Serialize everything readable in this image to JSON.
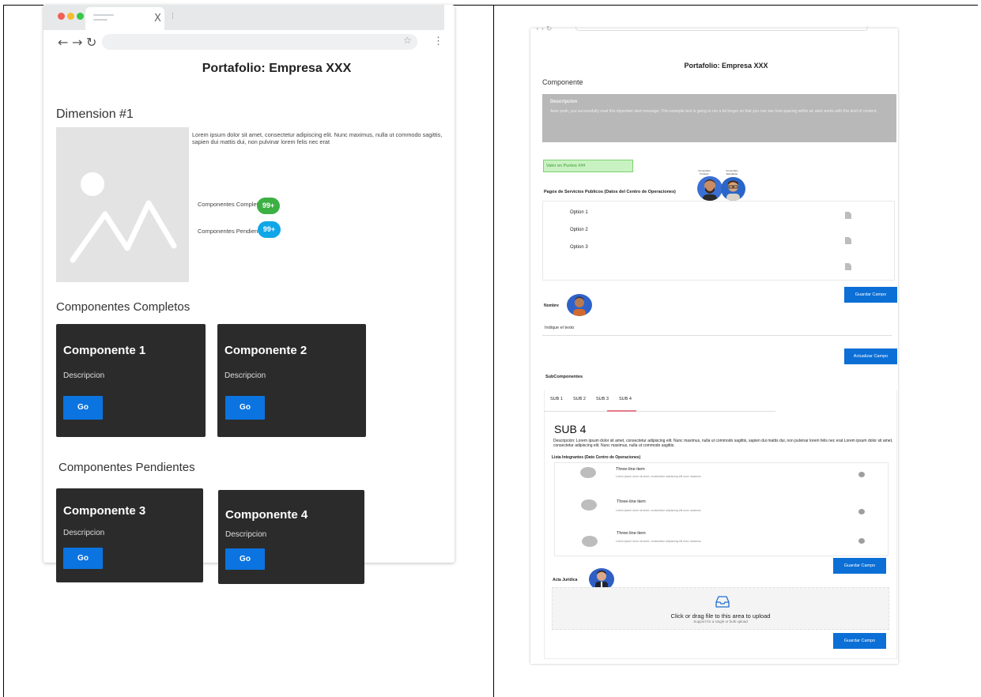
{
  "left": {
    "tab_close": "X",
    "page_title": "Portafolio: Empresa XXX",
    "dimension_title": "Dimension #1",
    "lorem": "Lorem ipsum dolor sit amet, consectetur adipiscing elit. Nunc maximus, nulla ut commodo sagittis, sapien dui mattis dui, non pulvinar lorem felis nec erat",
    "completos_label": "Componentes Completos",
    "completos_badge": "99+",
    "pendientes_label": "Componentes Pendientes",
    "pendientes_badge": "99+",
    "section_completos": "Componentes Completos",
    "section_pendientes": "Componentes Pendientes",
    "cards": [
      {
        "title": "Componente 1",
        "desc": "Descripcion",
        "button": "Go"
      },
      {
        "title": "Componente 2",
        "desc": "Descripcion",
        "button": "Go"
      },
      {
        "title": "Componente 3",
        "desc": "Descripcion",
        "button": "Go"
      },
      {
        "title": "Componente 4",
        "desc": "Descripcion",
        "button": "Go"
      }
    ],
    "colors": {
      "green": "#3cb043",
      "blue": "#10a6e8",
      "go_blue": "#0b74e0",
      "card": "#2b2b2b"
    }
  },
  "right": {
    "page_title": "Portafolio: Empresa XXX",
    "componente": "Componente",
    "desc_title": "Descripcion",
    "desc_body": "Aww yeah, you successfully read this important alert message. This example text is going to run a bit longer so that you can see how spacing within an alert works with this kind of content.",
    "valor": "Valor en Puntos    ###",
    "pagos_label": "Pagos de Servicios Publicos (Datos del Centro de Operaciones)",
    "avatar_labels": [
      "Comentario Profesor",
      "Comentario Estudiante"
    ],
    "options": [
      "Option 1",
      "Option 2",
      "Option 3"
    ],
    "guardar": "Guardar Campo",
    "nombre": "Nombre",
    "indique": "Indique el texto",
    "actualizar": "Actualizar Campo",
    "subcomponentes": "SubComponentes",
    "tabs": [
      "SUB 1",
      "SUB 2",
      "SUB 3",
      "SUB 4"
    ],
    "sub_title": "SUB 4",
    "sub_desc": "Descripción: Lorem ipsum dolor sit amet, consectetur adipiscing elit. Nunc maximus, nulla ut commodo sagittis, sapien dui mattis dui, non pulvinar lorem felis nec erat Lorem ipsum dolor sit amet, consectetur adipiscing elit. Nunc maximus, nulla ut commodo sagittis.",
    "lista_label": "Lista Integrantes (Dato Centro de Operaciones)",
    "list_items": [
      {
        "title": "Three-line item",
        "sub": "Lorem ipsum dolor sit amet, consectetur adipiscing elit nunc maximus"
      },
      {
        "title": "Three-line item",
        "sub": "Lorem ipsum dolor sit amet, consectetur adipiscing elit nunc maximus"
      },
      {
        "title": "Three-line item",
        "sub": "Lorem ipsum dolor sit amet, consectetur adipiscing elit nunc maximus"
      }
    ],
    "acta": "Acta Jurídica",
    "upload_title": "Click or drag file to this area to upload",
    "upload_sub": "Support for a single or bulk upload",
    "colors": {
      "primary": "#0b6fd6",
      "valor_bg": "#c9f2c3",
      "desc_bg": "#b8b8b8",
      "tab_active": "#e57b8a"
    }
  }
}
